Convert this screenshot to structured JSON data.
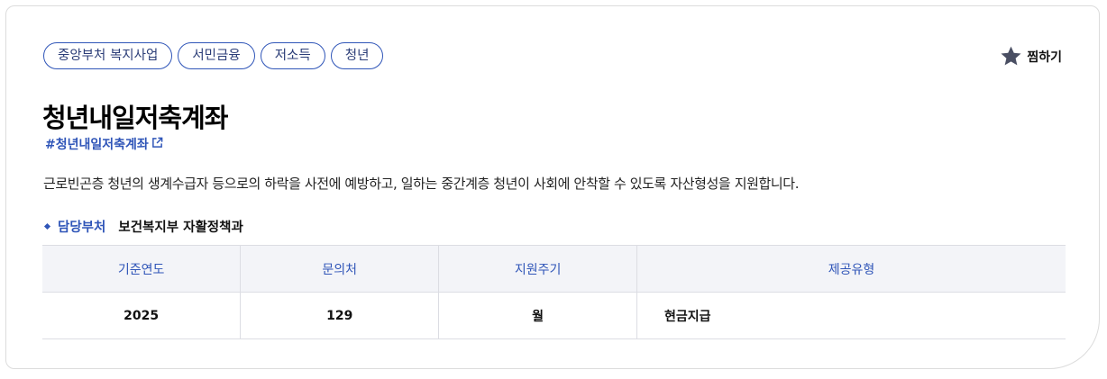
{
  "tags": [
    "중앙부처 복지사업",
    "서민금융",
    "저소득",
    "청년"
  ],
  "bookmark": {
    "label": "찜하기",
    "icon": "star-icon"
  },
  "title": "청년내일저축계좌",
  "hashtag": {
    "text": "#청년내일저축계좌",
    "icon": "external-link-icon"
  },
  "description": "근로빈곤층 청년의 생계수급자 등으로의 하락을 사전에 예방하고, 일하는 중간계층 청년이 사회에 안착할 수 있도록 자산형성을 지원합니다.",
  "department": {
    "label": "담당부처",
    "value": "보건복지부 자활정책과"
  },
  "table": {
    "headers": [
      "기준연도",
      "문의처",
      "지원주기",
      "제공유형"
    ],
    "rows": [
      [
        "2025",
        "129",
        "월",
        "현금지급"
      ]
    ]
  },
  "colors": {
    "accent": "#2f55b8",
    "header_bg": "#f3f4f8",
    "star": "#4a4f63"
  }
}
